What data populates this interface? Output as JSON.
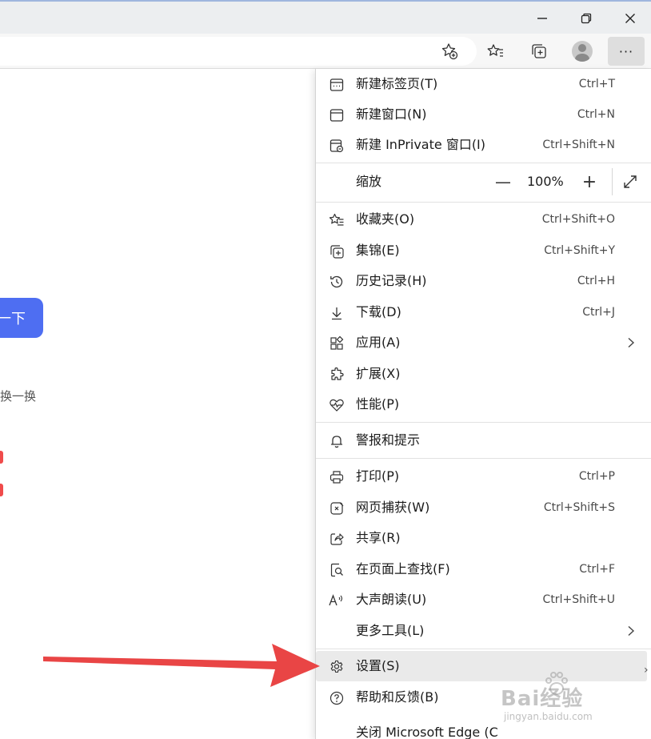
{
  "window": {
    "minimize_icon": "minimize-icon",
    "restore_icon": "restore-icon",
    "close_icon": "close-icon"
  },
  "toolbar": {
    "more_label": "···"
  },
  "page": {
    "search_button_label": "一下",
    "change_text": "换一换"
  },
  "menu": {
    "items_top": [
      {
        "label": "新建标签页(T)",
        "shortcut": "Ctrl+T",
        "icon": "new-tab-icon"
      },
      {
        "label": "新建窗口(N)",
        "shortcut": "Ctrl+N",
        "icon": "new-window-icon"
      },
      {
        "label": "新建 InPrivate 窗口(I)",
        "shortcut": "Ctrl+Shift+N",
        "icon": "inprivate-icon"
      }
    ],
    "zoom": {
      "label": "缩放",
      "minus": "—",
      "value": "100%",
      "plus": "+"
    },
    "items_mid": [
      {
        "label": "收藏夹(O)",
        "shortcut": "Ctrl+Shift+O",
        "icon": "favorites-icon"
      },
      {
        "label": "集锦(E)",
        "shortcut": "Ctrl+Shift+Y",
        "icon": "collections-icon"
      },
      {
        "label": "历史记录(H)",
        "shortcut": "Ctrl+H",
        "icon": "history-icon"
      },
      {
        "label": "下载(D)",
        "shortcut": "Ctrl+J",
        "icon": "download-icon"
      },
      {
        "label": "应用(A)",
        "shortcut": "",
        "icon": "apps-icon",
        "arrow": true
      },
      {
        "label": "扩展(X)",
        "shortcut": "",
        "icon": "extensions-icon"
      },
      {
        "label": "性能(P)",
        "shortcut": "",
        "icon": "performance-icon"
      }
    ],
    "items_alerts": [
      {
        "label": "警报和提示",
        "shortcut": "",
        "icon": "bell-icon"
      }
    ],
    "items_tools": [
      {
        "label": "打印(P)",
        "shortcut": "Ctrl+P",
        "icon": "print-icon"
      },
      {
        "label": "网页捕获(W)",
        "shortcut": "Ctrl+Shift+S",
        "icon": "web-capture-icon"
      },
      {
        "label": "共享(R)",
        "shortcut": "",
        "icon": "share-icon"
      },
      {
        "label": "在页面上查找(F)",
        "shortcut": "Ctrl+F",
        "icon": "find-icon"
      },
      {
        "label": "大声朗读(U)",
        "shortcut": "Ctrl+Shift+U",
        "icon": "read-aloud-icon"
      },
      {
        "label": "更多工具(L)",
        "shortcut": "",
        "icon": "",
        "arrow": true
      }
    ],
    "items_bottom": [
      {
        "label": "设置(S)",
        "icon": "gear-icon"
      },
      {
        "label": "帮助和反馈(B)",
        "icon": "help-icon"
      },
      {
        "label": "关闭 Microsoft Edge (C",
        "icon": ""
      }
    ]
  },
  "watermark": {
    "text": "Bai经验",
    "sub": "jingyan.baidu.com"
  },
  "colors": {
    "accent": "#4e6ef2",
    "annotation_arrow": "#e94545",
    "menu_highlight": "#eaeaea"
  }
}
